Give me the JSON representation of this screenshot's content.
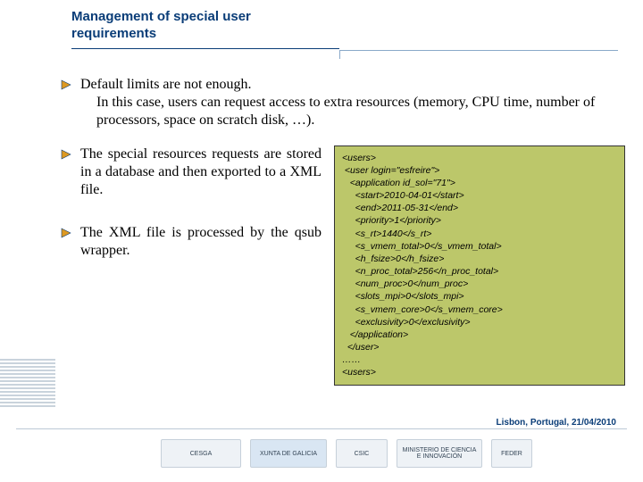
{
  "header": {
    "title_line1": "Management of special user",
    "title_line2": "requirements"
  },
  "bullets": {
    "b1": "Default limits are not enough.",
    "b1_sub": "In this case, users can request access to extra resources (memory, CPU time, number of processors, space on scratch disk, …).",
    "b2": "The special resources requests are stored in a database and then exported to a XML file.",
    "b3": "The XML file is processed by the qsub wrapper."
  },
  "code": "<users>\n <user login=\"esfreire\">\n   <application id_sol=\"71\">\n     <start>2010-04-01</start>\n     <end>2011-05-31</end>\n     <priority>1</priority>\n     <s_rt>1440</s_rt>\n     <s_vmem_total>0</s_vmem_total>\n     <h_fsize>0</h_fsize>\n     <n_proc_total>256</n_proc_total>\n     <num_proc>0</num_proc>\n     <slots_mpi>0</slots_mpi>\n     <s_vmem_core>0</s_vmem_core>\n     <exclusivity>0</exclusivity>\n   </application>\n  </user>\n……\n<users>",
  "footer": {
    "location_date": "Lisbon, Portugal, 21/04/2010",
    "logos": {
      "cesga": "CESGA",
      "xunta": "XUNTA DE GALICIA",
      "csic": "CSIC",
      "minist": "MINISTERIO DE CIENCIA E INNOVACIÓN",
      "eu": "FEDER"
    }
  },
  "colors": {
    "brand": "#0a3d78",
    "codebg": "#bcc76a"
  }
}
